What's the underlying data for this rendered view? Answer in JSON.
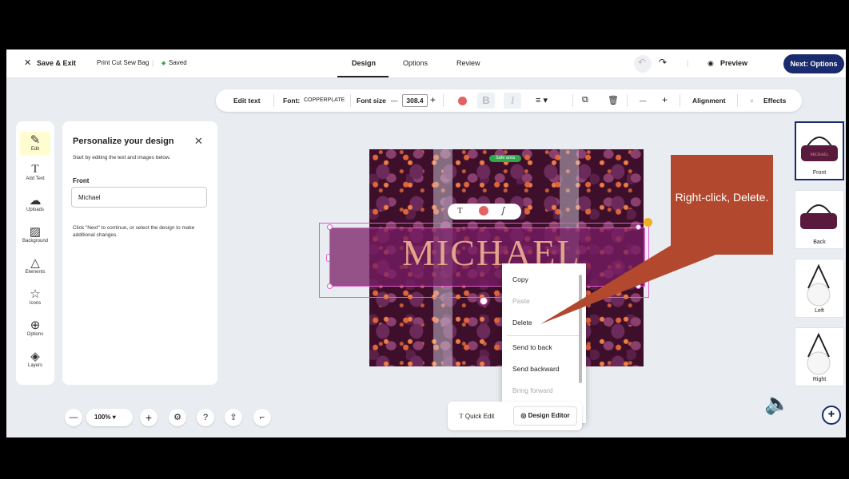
{
  "topbar": {
    "save_exit": "Save & Exit",
    "project_name": "Print Cut Sew Bag",
    "saved_status": "Saved",
    "tabs": [
      "Design",
      "Options",
      "Review"
    ],
    "preview": "Preview",
    "next": "Next: Options"
  },
  "toolbar": {
    "edit_text": "Edit text",
    "font_label": "Font:",
    "font_value": "COPPERPLATE",
    "font_size_label": "Font size",
    "font_size_value": "308.4",
    "bold": "B",
    "italic": "I",
    "alignment": "Alignment",
    "effects": "Effects",
    "text_color": "#e36363"
  },
  "sidebar": {
    "items": [
      {
        "label": "Edit",
        "icon": "magic-wand-icon"
      },
      {
        "label": "Add Text",
        "icon": "text-icon"
      },
      {
        "label": "Uploads",
        "icon": "cloud-upload-icon"
      },
      {
        "label": "Background",
        "icon": "background-icon"
      },
      {
        "label": "Elements",
        "icon": "shapes-icon"
      },
      {
        "label": "Icons",
        "icon": "star-icon"
      },
      {
        "label": "Options",
        "icon": "shirt-icon"
      },
      {
        "label": "Layers",
        "icon": "layers-icon"
      }
    ]
  },
  "panel": {
    "title": "Personalize your design",
    "description": "Start by editing the text and images below.",
    "field_label": "Front",
    "field_value": "Michael",
    "hint": "Click \"Next\" to continue, or select the design to make additional changes."
  },
  "canvas": {
    "safe_area": "Safe area",
    "name_text": "MICHAEL"
  },
  "context_menu": {
    "items": [
      {
        "label": "Copy",
        "disabled": false
      },
      {
        "label": "Paste",
        "disabled": true
      },
      {
        "label": "Delete",
        "disabled": false
      },
      {
        "label": "Send to back",
        "disabled": false
      },
      {
        "label": "Send backward",
        "disabled": false
      },
      {
        "label": "Bring forward",
        "disabled": true
      }
    ]
  },
  "callout": {
    "text": "Right-click, Delete.",
    "color": "#b2492f"
  },
  "views": [
    {
      "label": "Front",
      "selected": true
    },
    {
      "label": "Back",
      "selected": false
    },
    {
      "label": "Left",
      "selected": false
    },
    {
      "label": "Right",
      "selected": false
    }
  ],
  "bottom": {
    "zoom": "100%",
    "quick_edit": "Quick Edit",
    "design_editor": "Design Editor"
  },
  "colors": {
    "accent": "#1a2b6d",
    "saved": "#2fa84f",
    "selection": "#e05bd0"
  }
}
